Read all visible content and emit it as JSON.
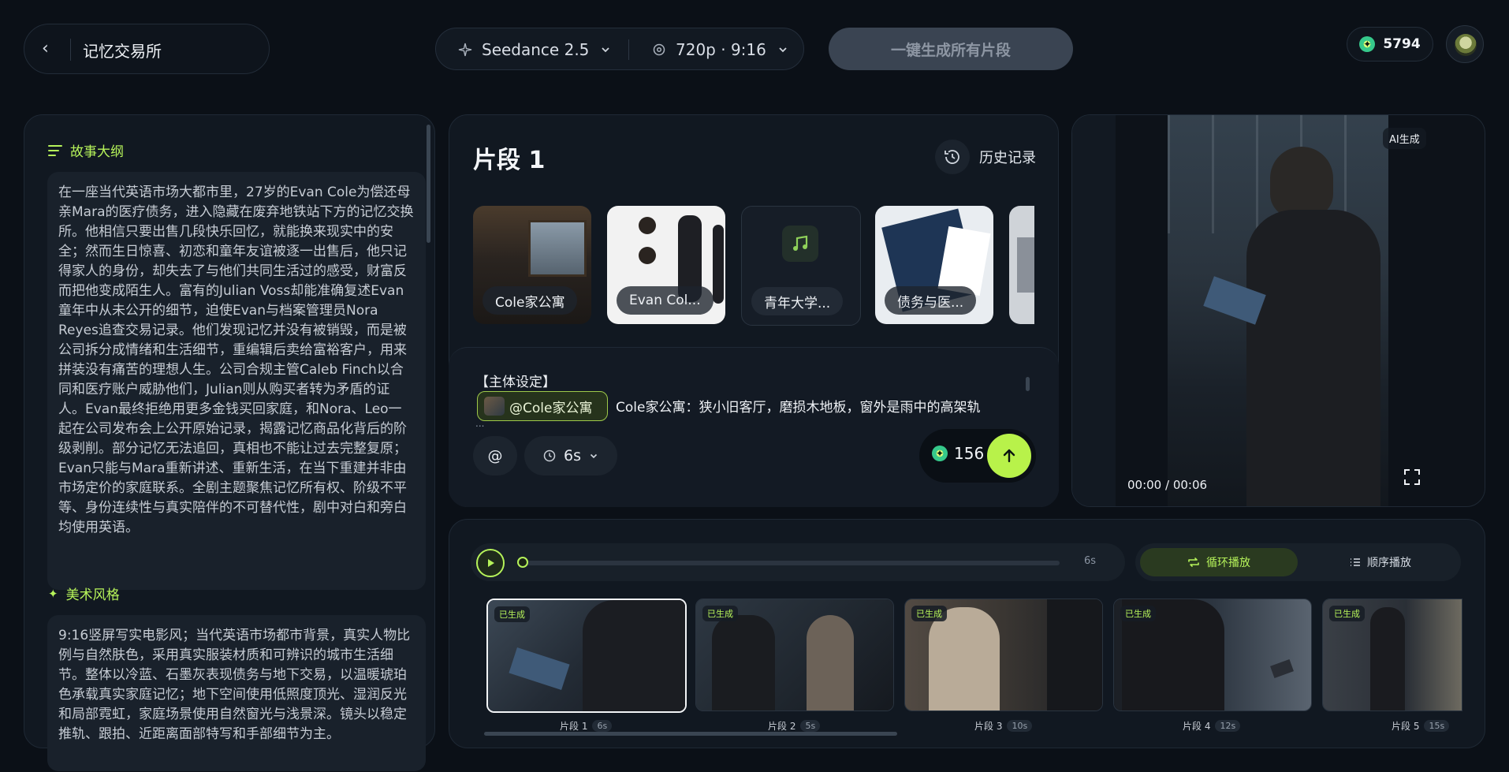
{
  "header": {
    "back_icon": "chevron-left-icon",
    "project_title": "记忆交易所",
    "model_name": "Seedance 2.5",
    "resolution_ratio": "720p · 9:16",
    "generate_all_label": "一键生成所有片段",
    "credits": "5794"
  },
  "outline": {
    "heading": "故事大纲",
    "text": "在一座当代英语市场大都市里，27岁的Evan Cole为偿还母亲Mara的医疗债务，进入隐藏在废弃地铁站下方的记忆交换所。他相信只要出售几段快乐回忆，就能换来现实中的安全；然而生日惊喜、初恋和童年友谊被逐一出售后，他只记得家人的身份，却失去了与他们共同生活过的感受，财富反而把他变成陌生人。富有的Julian Voss却能准确复述Evan童年中从未公开的细节，迫使Evan与档案管理员Nora Reyes追查交易记录。他们发现记忆并没有被销毁，而是被公司拆分成情绪和生活细节，重编辑后卖给富裕客户，用来拼装没有痛苦的理想人生。公司合规主管Caleb Finch以合同和医疗账户威胁他们，Julian则从购买者转为矛盾的证人。Evan最终拒绝用更多金钱买回家庭，和Nora、Leo一起在公司发布会上公开原始记录，揭露记忆商品化背后的阶级剥削。部分记忆无法追回，真相也不能让过去完整复原；Evan只能与Mara重新讲述、重新生活，在当下重建并非由市场定价的家庭联系。全剧主题聚焦记忆所有权、阶级不平等、身份连续性与真实陪伴的不可替代性，剧中对白和旁白均使用英语。"
  },
  "art_style": {
    "heading": "美术风格",
    "text": "9:16竖屏写实电影风；当代英语市场都市背景，真实人物比例与自然肤色，采用真实服装材质和可辨识的城市生活细节。整体以冷蓝、石墨灰表现债务与地下交易，以温暖琥珀色承载真实家庭记忆；地下空间使用低照度顶光、湿润反光和局部霓虹，家庭场景使用自然窗光与浅景深。镜头以稳定推轨、跟拍、近距离面部特写和手部细节为主。"
  },
  "segment": {
    "title": "片段 1",
    "history_label": "历史记录",
    "assets": [
      {
        "label": "Cole家公寓",
        "type": "image"
      },
      {
        "label": "Evan Col...",
        "type": "image"
      },
      {
        "label": "青年大学...",
        "type": "audio"
      },
      {
        "label": "债务与医...",
        "type": "image"
      },
      {
        "label": "",
        "type": "image"
      }
    ],
    "prompt_heading": "【主体设定】",
    "mention_label": "@Cole家公寓",
    "prompt_text": "Cole家公寓：狭小旧客厅，磨损木地板，窗外是雨中的高架轨",
    "prompt_overflow": "...",
    "at_label": "@",
    "duration_label": "6s",
    "cost": "156"
  },
  "video": {
    "ai_badge": "AI生成",
    "time": "00:00 / 00:06"
  },
  "timeline": {
    "end_time": "6s",
    "loop_label": "循环播放",
    "sequence_label": "顺序播放",
    "clips": [
      {
        "status": "已生成",
        "name": "片段 1",
        "duration": "6s"
      },
      {
        "status": "已生成",
        "name": "片段 2",
        "duration": "5s"
      },
      {
        "status": "已生成",
        "name": "片段 3",
        "duration": "10s"
      },
      {
        "status": "已生成",
        "name": "片段 4",
        "duration": "12s"
      },
      {
        "status": "已生成",
        "name": "片段 5",
        "duration": "15s"
      }
    ]
  }
}
